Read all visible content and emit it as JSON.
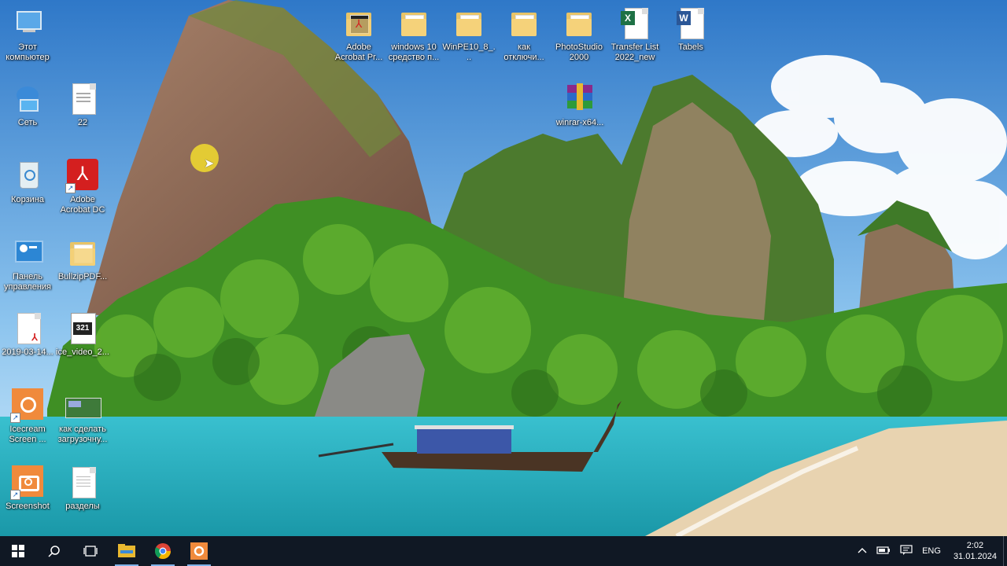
{
  "desktop_icons": [
    {
      "id": "this-pc",
      "label": "Этот\nкомпьютер"
    },
    {
      "id": "network",
      "label": "Сеть"
    },
    {
      "id": "recycle-bin",
      "label": "Корзина"
    },
    {
      "id": "control-panel",
      "label": "Панель\nуправления"
    },
    {
      "id": "pdf-2019",
      "label": "2019-03-14..."
    },
    {
      "id": "icecream",
      "label": "Icecream\nScreen ..."
    },
    {
      "id": "screenshot",
      "label": "Screenshot"
    },
    {
      "id": "doc-22",
      "label": "22"
    },
    {
      "id": "adobe-dc",
      "label": "Adobe\nAcrobat DC"
    },
    {
      "id": "bullzip",
      "label": "BullzipPDF..."
    },
    {
      "id": "ice-video",
      "label": "ice_video_2..."
    },
    {
      "id": "boot-video",
      "label": "как сделать\nзагрузочну..."
    },
    {
      "id": "razdely",
      "label": "разделы"
    },
    {
      "id": "adobe-pro",
      "label": "Adobe\nAcrobat Pr..."
    },
    {
      "id": "win10",
      "label": "windows 10\nсредство п..."
    },
    {
      "id": "winpe",
      "label": "WinPE10_8_..."
    },
    {
      "id": "kak-otkl",
      "label": "как\nотключи..."
    },
    {
      "id": "photostudio",
      "label": "PhotoStudio\n2000"
    },
    {
      "id": "transfer",
      "label": "Transfer List\n2022_new"
    },
    {
      "id": "tabels",
      "label": "Tabels"
    },
    {
      "id": "winrar",
      "label": "winrar-x64..."
    }
  ],
  "taskbar": {
    "items": [
      "start-icon",
      "search-icon",
      "task-view-icon",
      "file-explorer-icon",
      "chrome-icon",
      "icecream-icon"
    ],
    "tray": {
      "language": "ENG",
      "time": "2:02",
      "date": "31.01.2024"
    }
  },
  "colors": {
    "taskbar": "#101824",
    "accent": "#7fb2e8",
    "sea": "#2bb5c0",
    "sky": "#3e8ad6"
  }
}
